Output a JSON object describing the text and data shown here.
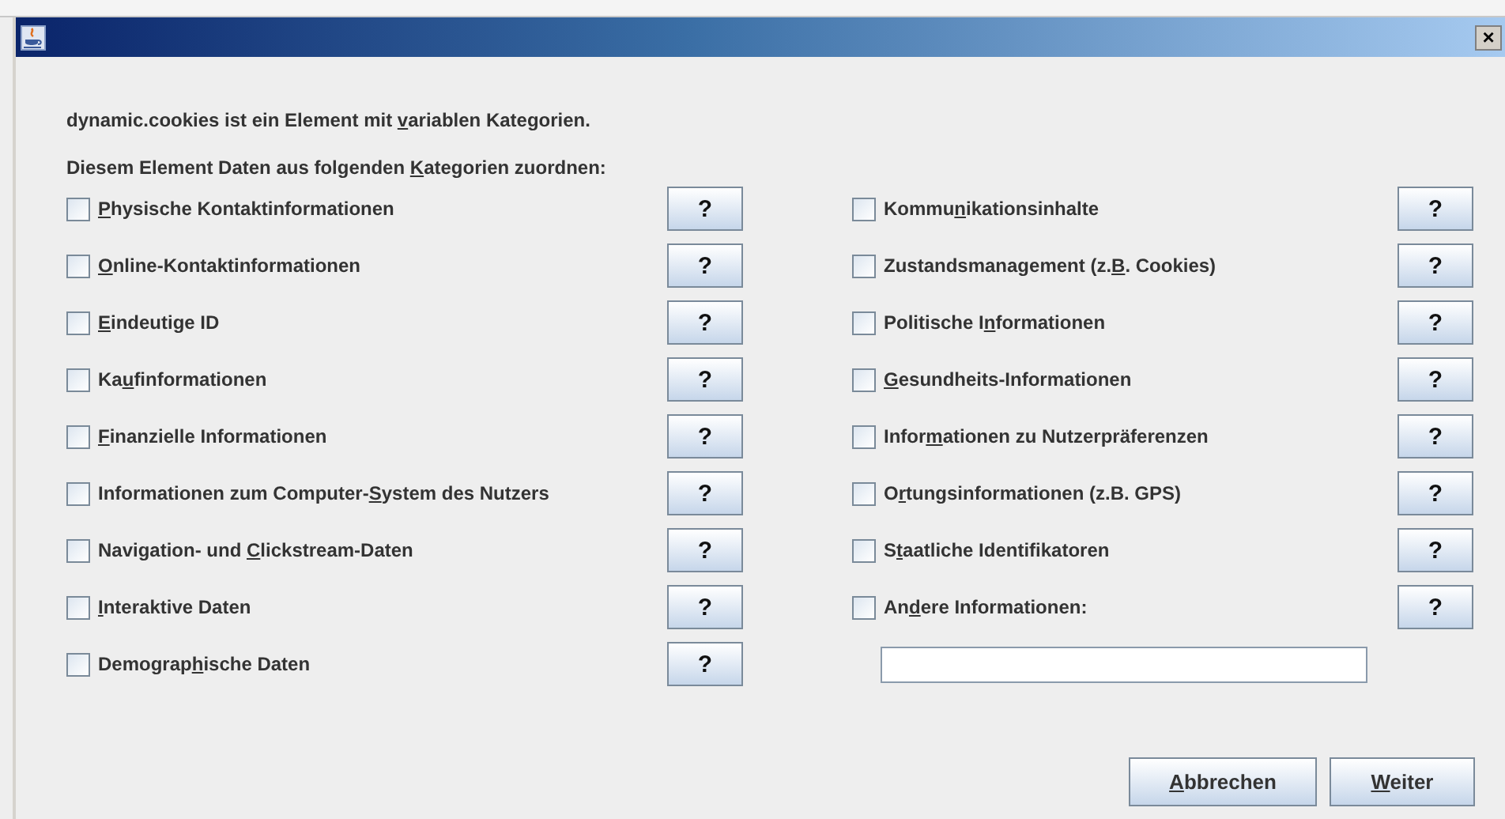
{
  "window": {
    "close_label": "×"
  },
  "intro": [
    {
      "before": "dynamic.cookies ist ein Element mit ",
      "key": "v",
      "after": "ariablen Kategorien."
    },
    {
      "before": "Diesem Element Daten aus folgenden ",
      "key": "K",
      "after": "ategorien zuordnen:"
    }
  ],
  "columns": [
    {
      "items": [
        {
          "label": {
            "key": "P",
            "after": "hysische Kontaktinformationen"
          },
          "checked": false,
          "help": "?"
        },
        {
          "label": {
            "key": "O",
            "after": "nline-Kontaktinformationen"
          },
          "checked": false,
          "help": "?"
        },
        {
          "label": {
            "key": "E",
            "after": "indeutige ID"
          },
          "checked": false,
          "help": "?"
        },
        {
          "label": {
            "before": "Ka",
            "key": "u",
            "after": "finformationen"
          },
          "checked": false,
          "help": "?"
        },
        {
          "label": {
            "key": "F",
            "after": "inanzielle Informationen"
          },
          "checked": false,
          "help": "?"
        },
        {
          "label": {
            "before": "Informationen zum Computer-",
            "key": "S",
            "after": "ystem des Nutzers"
          },
          "checked": false,
          "help": "?"
        },
        {
          "label": {
            "before": "Navigation- und ",
            "key": "C",
            "after": "lickstream-Daten"
          },
          "checked": false,
          "help": "?"
        },
        {
          "label": {
            "key": "I",
            "after": "nteraktive Daten"
          },
          "checked": false,
          "help": "?"
        },
        {
          "label": {
            "before": "Demograp",
            "key": "h",
            "after": "ische Daten"
          },
          "checked": false,
          "help": "?"
        }
      ]
    },
    {
      "items": [
        {
          "label": {
            "before": "Kommu",
            "key": "n",
            "after": "ikationsinhalte"
          },
          "checked": false,
          "help": "?"
        },
        {
          "label": {
            "before": "Zustandsmanagement (z.",
            "key": "B",
            "after": ". Cookies)"
          },
          "checked": false,
          "help": "?"
        },
        {
          "label": {
            "before": "Politische I",
            "key": "n",
            "after": "formationen"
          },
          "checked": false,
          "help": "?"
        },
        {
          "label": {
            "key": "G",
            "after": "esundheits-Informationen"
          },
          "checked": false,
          "help": "?"
        },
        {
          "label": {
            "before": "Infor",
            "key": "m",
            "after": "ationen zu Nutzerpräferenzen"
          },
          "checked": false,
          "help": "?"
        },
        {
          "label": {
            "before": "O",
            "key": "r",
            "after": "tungsinformationen (z.B. GPS)"
          },
          "checked": false,
          "help": "?"
        },
        {
          "label": {
            "before": "S",
            "key": "t",
            "after": "aatliche Identifikatoren"
          },
          "checked": false,
          "help": "?"
        },
        {
          "label": {
            "before": "An",
            "key": "d",
            "after": "ere Informationen:"
          },
          "checked": false,
          "help": "?"
        }
      ],
      "other_field": {
        "kind": "text"
      }
    }
  ],
  "buttons": [
    {
      "label": {
        "key": "A",
        "after": "bbrechen"
      }
    },
    {
      "label": {
        "key": "W",
        "after": "eiter"
      }
    }
  ]
}
